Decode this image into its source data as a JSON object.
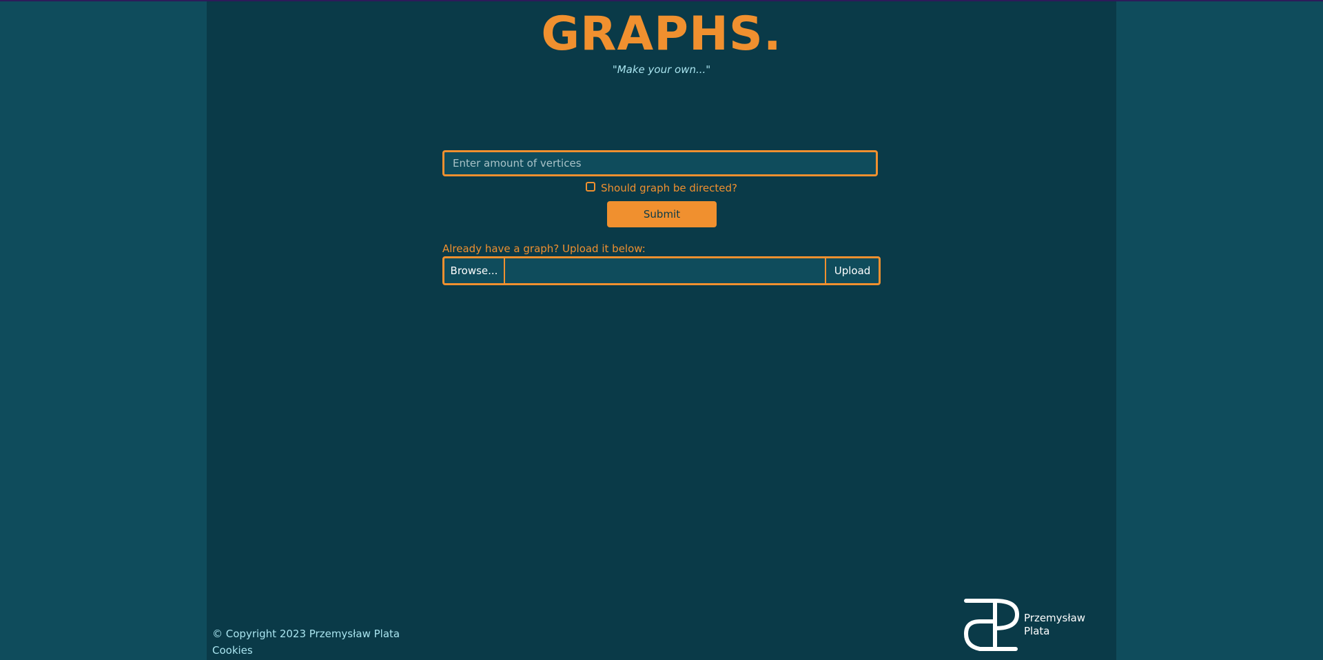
{
  "header": {
    "title": "GRAPHS.",
    "subtitle": "\"Make your own...\""
  },
  "form": {
    "vertices_placeholder": "Enter amount of vertices",
    "directed_label": "Should graph be directed?",
    "directed_checked": false,
    "submit_label": "Submit"
  },
  "upload": {
    "prompt": "Already have a graph? Upload it below:",
    "browse_label": "Browse...",
    "file_value": "",
    "upload_label": "Upload"
  },
  "footer": {
    "copyright": "© Copyright 2023 Przemysław Plata",
    "cookies_link": "Cookies"
  },
  "logo": {
    "line1": "Przemysław",
    "line2": "Plata"
  },
  "colors": {
    "accent": "#f0902f",
    "page_background": "#0f4c5c",
    "content_background": "#0a3a48",
    "subtitle_text": "#a9e4ef"
  }
}
